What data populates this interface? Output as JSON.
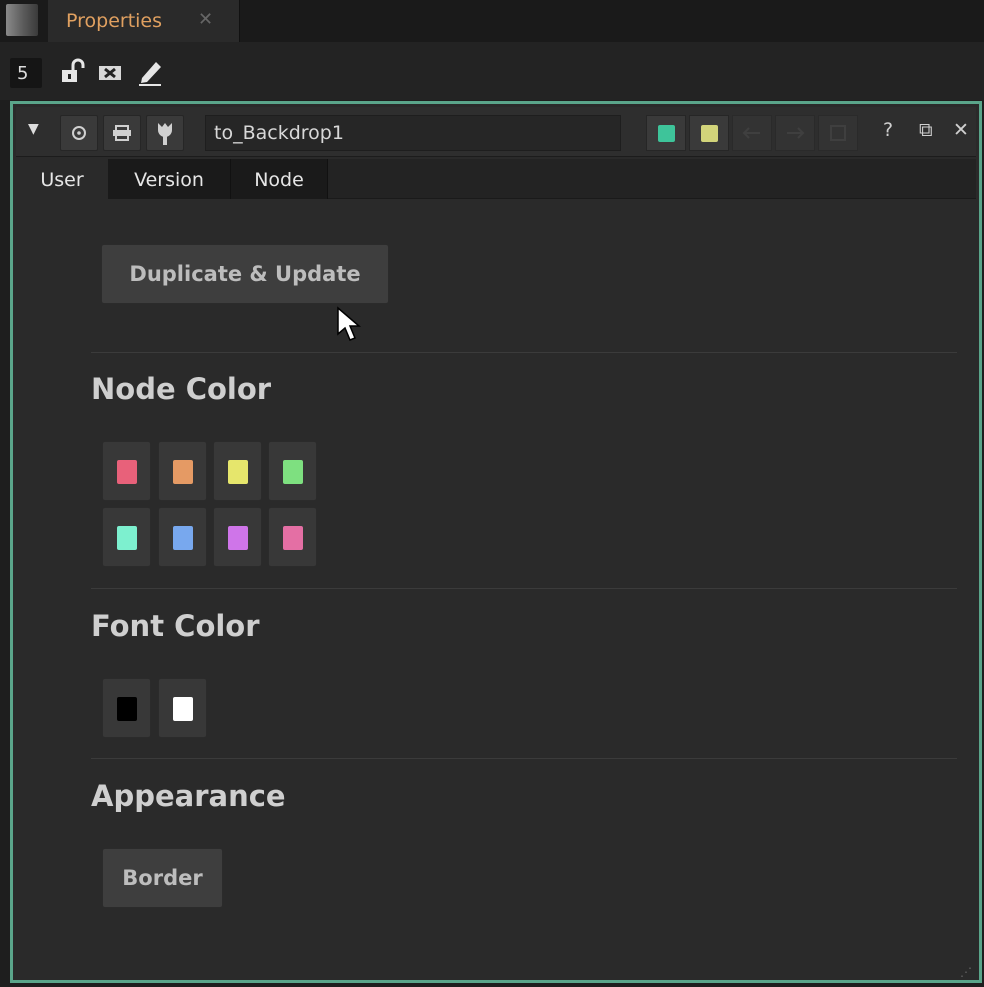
{
  "tabbar": {
    "tab_label": "Properties",
    "close_glyph": "✕",
    "tab_color": "#e0a060"
  },
  "toolbar": {
    "max_panels_value": "5",
    "icons": [
      "lock-icon",
      "clear-panels-icon",
      "edit-icon"
    ]
  },
  "node": {
    "name": "to_Backdrop1",
    "tile_color": "#3ec49a",
    "gl_color": "#d2d47a",
    "help_label": "?",
    "float_label": "⧉",
    "close_label": "✕"
  },
  "tabs": [
    {
      "label": "User",
      "active": true
    },
    {
      "label": "Version",
      "active": false
    },
    {
      "label": "Node",
      "active": false
    }
  ],
  "content": {
    "duplicate_label": "Duplicate & Update",
    "node_color_title": "Node Color",
    "node_colors": [
      "#e8617a",
      "#e59a64",
      "#e6e66c",
      "#7ee080",
      "#7df0cf",
      "#78a8ee",
      "#cf75e9",
      "#e46fa4"
    ],
    "font_color_title": "Font Color",
    "font_colors": [
      "#000000",
      "#ffffff"
    ],
    "appearance_title": "Appearance",
    "border_label": "Border"
  }
}
